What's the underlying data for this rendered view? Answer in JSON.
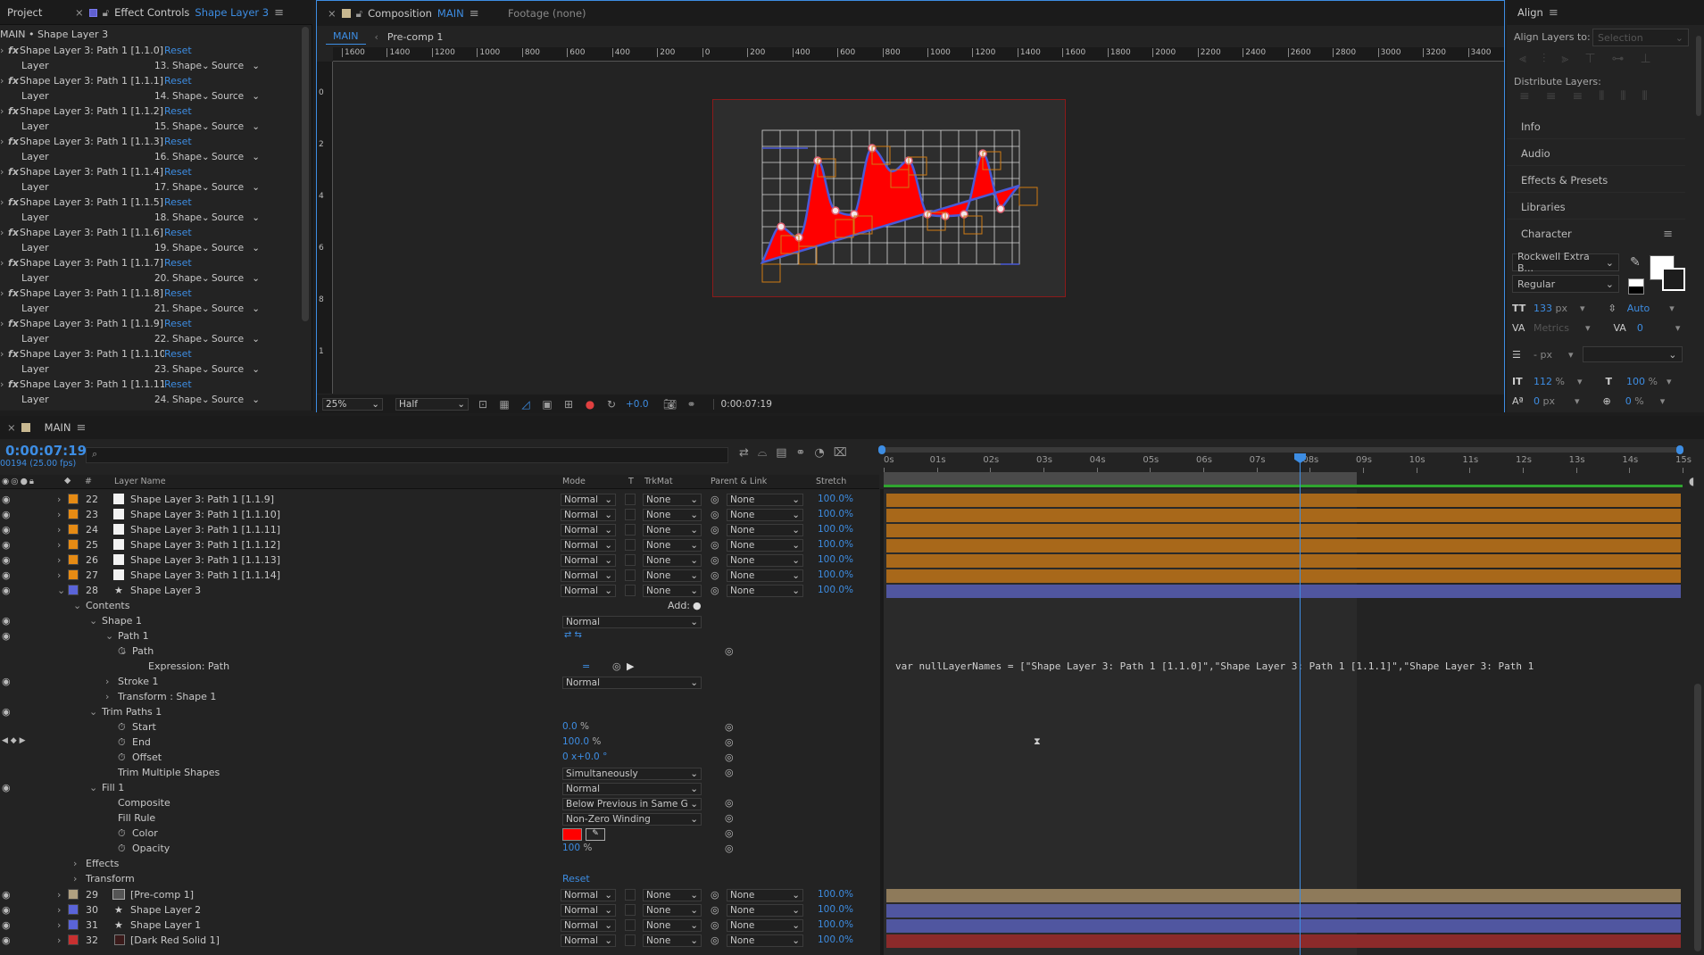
{
  "colors": {
    "accent": "#3d8de3",
    "layer_orange": "#a8681a",
    "layer_blue": "#5056a0",
    "layer_tan": "#8e7a5a",
    "layer_red": "#8c2a2a",
    "fill_red": "#ff0000",
    "path_blue": "#4a5ad8"
  },
  "left_panel": {
    "tab_project": "Project",
    "tab_effect_controls": "Effect Controls",
    "tab_effect_target": "Shape Layer 3",
    "breadcrumb": "MAIN • Shape Layer 3",
    "effects": [
      {
        "name": "Shape Layer 3: Path 1 [1.1.0]",
        "layer_value": "13. Shape"
      },
      {
        "name": "Shape Layer 3: Path 1 [1.1.1]",
        "layer_value": "14. Shape"
      },
      {
        "name": "Shape Layer 3: Path 1 [1.1.2]",
        "layer_value": "15. Shape"
      },
      {
        "name": "Shape Layer 3: Path 1 [1.1.3]",
        "layer_value": "16. Shape"
      },
      {
        "name": "Shape Layer 3: Path 1 [1.1.4]",
        "layer_value": "17. Shape"
      },
      {
        "name": "Shape Layer 3: Path 1 [1.1.5]",
        "layer_value": "18. Shape"
      },
      {
        "name": "Shape Layer 3: Path 1 [1.1.6]",
        "layer_value": "19. Shape"
      },
      {
        "name": "Shape Layer 3: Path 1 [1.1.7]",
        "layer_value": "20. Shape"
      },
      {
        "name": "Shape Layer 3: Path 1 [1.1.8]",
        "layer_value": "21. Shape"
      },
      {
        "name": "Shape Layer 3: Path 1 [1.1.9]",
        "layer_value": "22. Shape"
      },
      {
        "name": "Shape Layer 3: Path 1 [1.1.10]",
        "layer_value": "23. Shape"
      },
      {
        "name": "Shape Layer 3: Path 1 [1.1.11]",
        "layer_value": "24. Shape"
      }
    ],
    "reset_label": "Reset",
    "layer_label": "Layer",
    "source_label": "Source"
  },
  "comp_panel": {
    "tab_label": "Composition",
    "tab_comp_name": "MAIN",
    "footage_label": "Footage (none)",
    "crumbs": [
      "MAIN",
      "Pre-comp 1"
    ],
    "ruler_ticks": [
      "1600",
      "1400",
      "1200",
      "1000",
      "800",
      "600",
      "400",
      "200",
      "0",
      "200",
      "400",
      "600",
      "800",
      "1000",
      "1200",
      "1400",
      "1600",
      "1800",
      "2000",
      "2200",
      "2400",
      "2600",
      "2800",
      "3000",
      "3200",
      "3400"
    ],
    "vruler_ticks": [
      "0",
      "2",
      "4",
      "6",
      "8",
      "1"
    ],
    "zoom": "25%",
    "resolution": "Half",
    "exposure": "+0.0",
    "timecode": "0:00:07:19"
  },
  "right_panel": {
    "align_title": "Align",
    "align_layers_to": "Align Layers to:",
    "align_target": "Selection",
    "distribute_layers": "Distribute Layers:",
    "sections": [
      "Info",
      "Audio",
      "Effects & Presets",
      "Libraries"
    ],
    "character_title": "Character",
    "font_family": "Rockwell Extra B...",
    "font_style": "Regular",
    "font_size": "133",
    "font_size_unit": "px",
    "leading": "Auto",
    "kerning": "Metrics",
    "tracking": "0",
    "stroke_width_unit": "- px",
    "vert_scale": "112",
    "horiz_scale": "100",
    "percent": "%",
    "baseline": "0",
    "baseline_unit": "px",
    "tsume": "0",
    "tsume_unit": "%"
  },
  "timeline": {
    "tab_label": "MAIN",
    "timecode": "0:00:07:19",
    "frame_info": "00194 (25.00 fps)",
    "search_placeholder": "",
    "col_layer_name": "Layer Name",
    "col_mode": "Mode",
    "col_t": "T",
    "col_trkmat": "TrkMat",
    "col_parent": "Parent & Link",
    "col_stretch": "Stretch",
    "col_num": "#",
    "time_ticks": [
      "0s",
      "01s",
      "02s",
      "03s",
      "04s",
      "05s",
      "06s",
      "07s",
      "08s",
      "09s",
      "10s",
      "11s",
      "12s",
      "13s",
      "14s",
      "15s"
    ],
    "layers_top": [
      {
        "num": "22",
        "name": "Shape Layer 3: Path 1 [1.1.9]",
        "mode": "Normal",
        "trkmat": "None",
        "parent": "None",
        "stretch": "100.0%"
      },
      {
        "num": "23",
        "name": "Shape Layer 3: Path 1 [1.1.10]",
        "mode": "Normal",
        "trkmat": "None",
        "parent": "None",
        "stretch": "100.0%"
      },
      {
        "num": "24",
        "name": "Shape Layer 3: Path 1 [1.1.11]",
        "mode": "Normal",
        "trkmat": "None",
        "parent": "None",
        "stretch": "100.0%"
      },
      {
        "num": "25",
        "name": "Shape Layer 3: Path 1 [1.1.12]",
        "mode": "Normal",
        "trkmat": "None",
        "parent": "None",
        "stretch": "100.0%"
      },
      {
        "num": "26",
        "name": "Shape Layer 3: Path 1 [1.1.13]",
        "mode": "Normal",
        "trkmat": "None",
        "parent": "None",
        "stretch": "100.0%"
      },
      {
        "num": "27",
        "name": "Shape Layer 3: Path 1 [1.1.14]",
        "mode": "Normal",
        "trkmat": "None",
        "parent": "None",
        "stretch": "100.0%"
      },
      {
        "num": "28",
        "name": "Shape Layer 3",
        "mode": "Normal",
        "trkmat": "None",
        "parent": "None",
        "stretch": "100.0%"
      }
    ],
    "props": {
      "contents": "Contents",
      "add": "Add:",
      "shape1": "Shape 1",
      "shape1_mode": "Normal",
      "path1": "Path 1",
      "path": "Path",
      "expr_path": "Expression: Path",
      "stroke1": "Stroke 1",
      "stroke1_mode": "Normal",
      "transform_shape1": "Transform : Shape 1",
      "trim_paths": "Trim Paths 1",
      "start": "Start",
      "start_val": "0.0",
      "end": "End",
      "end_val": "100.0",
      "offset": "Offset",
      "offset_val": "0 x+0.0 °",
      "trim_multiple": "Trim Multiple Shapes",
      "trim_multiple_val": "Simultaneously",
      "fill1": "Fill 1",
      "fill1_mode": "Normal",
      "composite": "Composite",
      "composite_val": "Below Previous in Same G",
      "fill_rule": "Fill Rule",
      "fill_rule_val": "Non-Zero Winding",
      "color": "Color",
      "opacity": "Opacity",
      "opacity_val": "100",
      "effects": "Effects",
      "transform": "Transform",
      "reset": "Reset",
      "pct": "%"
    },
    "expression_text": "var nullLayerNames = [\"Shape Layer 3: Path 1 [1.1.0]\",\"Shape Layer 3: Path 1 [1.1.1]\",\"Shape Layer 3: Path 1",
    "layers_bottom": [
      {
        "num": "29",
        "name": "[Pre-comp 1]",
        "mode": "Normal",
        "trkmat": "None",
        "parent": "None",
        "stretch": "100.0%"
      },
      {
        "num": "30",
        "name": "Shape Layer 2",
        "mode": "Normal",
        "trkmat": "None",
        "parent": "None",
        "stretch": "100.0%"
      },
      {
        "num": "31",
        "name": "Shape Layer 1",
        "mode": "Normal",
        "trkmat": "None",
        "parent": "None",
        "stretch": "100.0%"
      },
      {
        "num": "32",
        "name": "[Dark Red Solid 1]",
        "mode": "Normal",
        "trkmat": "None",
        "parent": "None",
        "stretch": "100.0%"
      }
    ]
  }
}
